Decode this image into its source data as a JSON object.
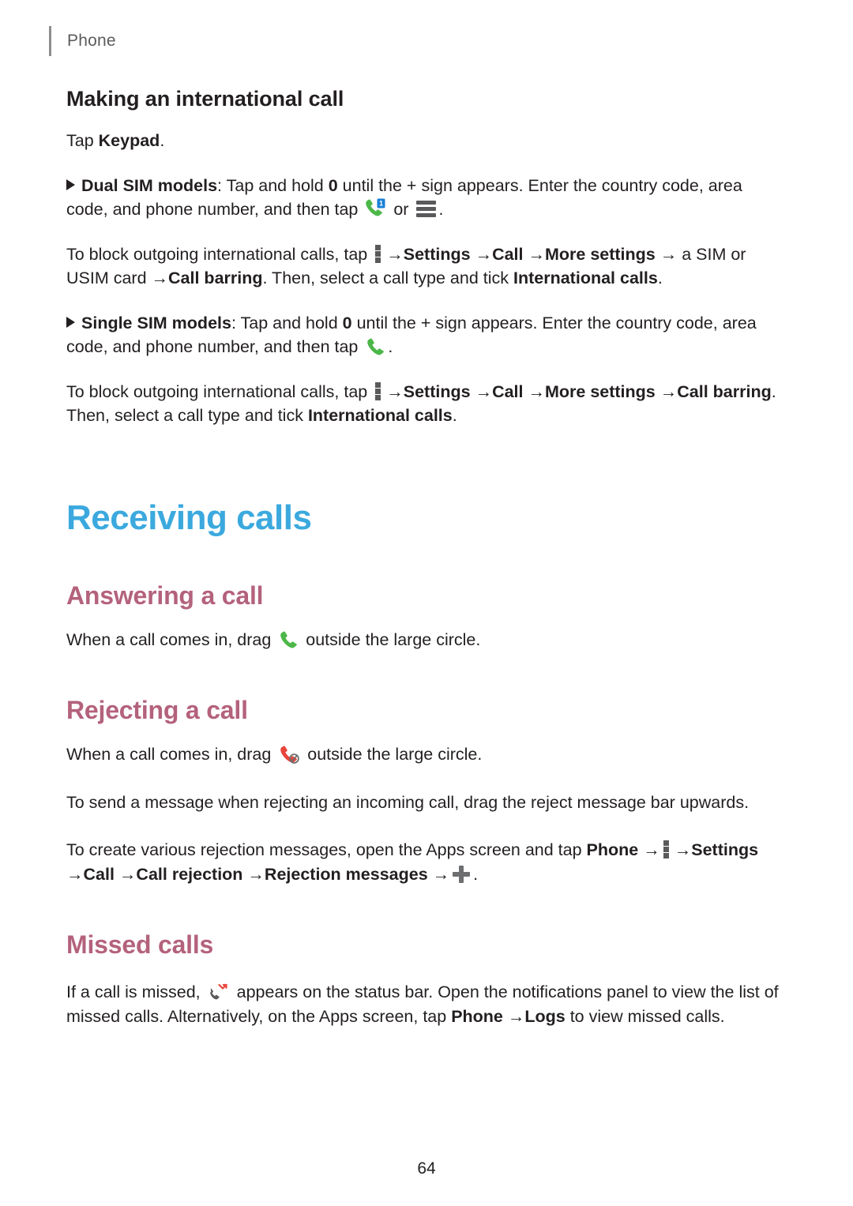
{
  "document": {
    "running_head": "Phone",
    "page_number": "64"
  },
  "colors": {
    "chapter_heading": "#3ba9de",
    "section_heading": "#b4627c",
    "body_text": "#231f20",
    "running_head": "#5b5b5b",
    "icon_gray": "#59595b",
    "icon_green": "#4cb749",
    "icon_red": "#e8453c"
  },
  "sections": {
    "international_call": {
      "heading": "Making an international call",
      "intro_prefix": "Tap ",
      "intro_bold": "Keypad",
      "intro_suffix": ".",
      "dual_sim": {
        "label": "Dual SIM models",
        "colon": ": ",
        "text_a": "Tap and hold ",
        "zero": "0",
        "text_b": " until the + sign appears. Enter the country code, area code, and phone number, and then tap ",
        "or": " or ",
        "text_c": "."
      },
      "dual_sim_block": {
        "p1": "To block outgoing international calls, tap ",
        "settings": "Settings",
        "call": "Call",
        "more_settings": "More settings",
        "a_sim_or": " a SIM or ",
        "usim_card": "USIM card ",
        "call_barring": "Call barring",
        "then_select": ". Then, select a call type and tick ",
        "international_calls": "International calls",
        "period": "."
      },
      "single_sim": {
        "label": "Single SIM models",
        "colon": ": ",
        "text_a": "Tap and hold ",
        "zero": "0",
        "text_b": " until the + sign appears. Enter the country code, area code, and phone number, and then tap ",
        "text_c": "."
      },
      "single_sim_block": {
        "p1": "To block outgoing international calls, tap ",
        "settings": "Settings",
        "call": "Call",
        "more_settings": "More settings",
        "call_barring_a": "Call ",
        "call_barring_b": "barring",
        "then_select": ". Then, select a call type and tick ",
        "international_calls": "International calls",
        "period": "."
      }
    },
    "receiving_calls": {
      "heading": "Receiving calls",
      "answering": {
        "heading": "Answering a call",
        "text_a": "When a call comes in, drag ",
        "text_b": " outside the large circle."
      },
      "rejecting": {
        "heading": "Rejecting a call",
        "text_a": "When a call comes in, drag ",
        "text_b": " outside the large circle.",
        "para2": "To send a message when rejecting an incoming call, drag the reject message bar upwards.",
        "para3_a": "To create various rejection messages, open the Apps screen and tap ",
        "phone": "Phone",
        "settings": "Settings",
        "call": "Call",
        "call_rejection": "Call rejection",
        "rejection_messages": "Rejection messages",
        "period": "."
      },
      "missed": {
        "heading": "Missed calls",
        "text_a": "If a call is missed, ",
        "text_b": " appears on the status bar. Open the notifications panel to view the list of missed calls. Alternatively, on the Apps screen, tap ",
        "phone": "Phone",
        "logs": "Logs",
        "text_c": " to view missed calls."
      }
    }
  },
  "icons": {
    "more_options": "more-options-icon",
    "call": "call-handset-icon",
    "call_sim": "call-handset-sim-icon",
    "sim_list": "sim-list-icon",
    "reject_call": "reject-call-icon",
    "missed_call": "missed-call-icon",
    "add": "add-plus-icon"
  },
  "glyphs": {
    "arrow": "→"
  }
}
